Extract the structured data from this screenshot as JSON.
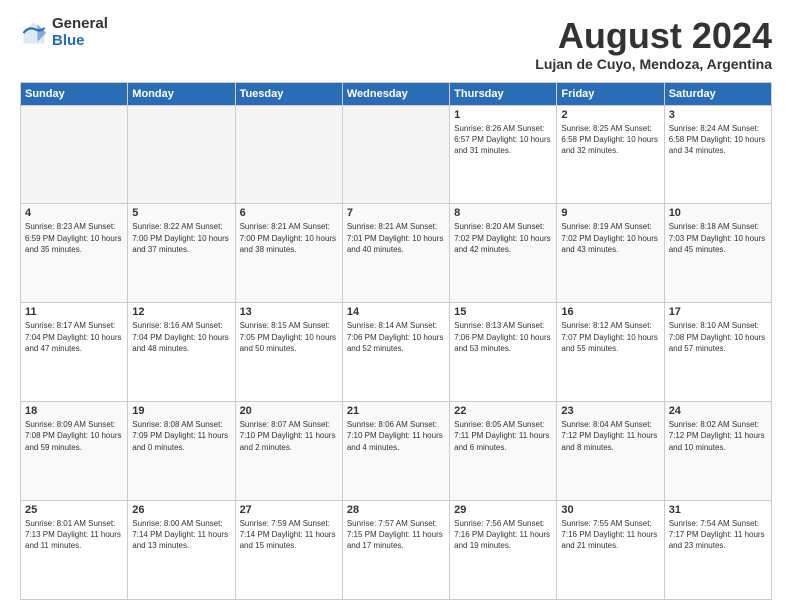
{
  "logo": {
    "general": "General",
    "blue": "Blue"
  },
  "title": "August 2024",
  "subtitle": "Lujan de Cuyo, Mendoza, Argentina",
  "headers": [
    "Sunday",
    "Monday",
    "Tuesday",
    "Wednesday",
    "Thursday",
    "Friday",
    "Saturday"
  ],
  "weeks": [
    [
      {
        "day": "",
        "info": ""
      },
      {
        "day": "",
        "info": ""
      },
      {
        "day": "",
        "info": ""
      },
      {
        "day": "",
        "info": ""
      },
      {
        "day": "1",
        "info": "Sunrise: 8:26 AM\nSunset: 6:57 PM\nDaylight: 10 hours\nand 31 minutes."
      },
      {
        "day": "2",
        "info": "Sunrise: 8:25 AM\nSunset: 6:58 PM\nDaylight: 10 hours\nand 32 minutes."
      },
      {
        "day": "3",
        "info": "Sunrise: 8:24 AM\nSunset: 6:58 PM\nDaylight: 10 hours\nand 34 minutes."
      }
    ],
    [
      {
        "day": "4",
        "info": "Sunrise: 8:23 AM\nSunset: 6:59 PM\nDaylight: 10 hours\nand 35 minutes."
      },
      {
        "day": "5",
        "info": "Sunrise: 8:22 AM\nSunset: 7:00 PM\nDaylight: 10 hours\nand 37 minutes."
      },
      {
        "day": "6",
        "info": "Sunrise: 8:21 AM\nSunset: 7:00 PM\nDaylight: 10 hours\nand 38 minutes."
      },
      {
        "day": "7",
        "info": "Sunrise: 8:21 AM\nSunset: 7:01 PM\nDaylight: 10 hours\nand 40 minutes."
      },
      {
        "day": "8",
        "info": "Sunrise: 8:20 AM\nSunset: 7:02 PM\nDaylight: 10 hours\nand 42 minutes."
      },
      {
        "day": "9",
        "info": "Sunrise: 8:19 AM\nSunset: 7:02 PM\nDaylight: 10 hours\nand 43 minutes."
      },
      {
        "day": "10",
        "info": "Sunrise: 8:18 AM\nSunset: 7:03 PM\nDaylight: 10 hours\nand 45 minutes."
      }
    ],
    [
      {
        "day": "11",
        "info": "Sunrise: 8:17 AM\nSunset: 7:04 PM\nDaylight: 10 hours\nand 47 minutes."
      },
      {
        "day": "12",
        "info": "Sunrise: 8:16 AM\nSunset: 7:04 PM\nDaylight: 10 hours\nand 48 minutes."
      },
      {
        "day": "13",
        "info": "Sunrise: 8:15 AM\nSunset: 7:05 PM\nDaylight: 10 hours\nand 50 minutes."
      },
      {
        "day": "14",
        "info": "Sunrise: 8:14 AM\nSunset: 7:06 PM\nDaylight: 10 hours\nand 52 minutes."
      },
      {
        "day": "15",
        "info": "Sunrise: 8:13 AM\nSunset: 7:06 PM\nDaylight: 10 hours\nand 53 minutes."
      },
      {
        "day": "16",
        "info": "Sunrise: 8:12 AM\nSunset: 7:07 PM\nDaylight: 10 hours\nand 55 minutes."
      },
      {
        "day": "17",
        "info": "Sunrise: 8:10 AM\nSunset: 7:08 PM\nDaylight: 10 hours\nand 57 minutes."
      }
    ],
    [
      {
        "day": "18",
        "info": "Sunrise: 8:09 AM\nSunset: 7:08 PM\nDaylight: 10 hours\nand 59 minutes."
      },
      {
        "day": "19",
        "info": "Sunrise: 8:08 AM\nSunset: 7:09 PM\nDaylight: 11 hours\nand 0 minutes."
      },
      {
        "day": "20",
        "info": "Sunrise: 8:07 AM\nSunset: 7:10 PM\nDaylight: 11 hours\nand 2 minutes."
      },
      {
        "day": "21",
        "info": "Sunrise: 8:06 AM\nSunset: 7:10 PM\nDaylight: 11 hours\nand 4 minutes."
      },
      {
        "day": "22",
        "info": "Sunrise: 8:05 AM\nSunset: 7:11 PM\nDaylight: 11 hours\nand 6 minutes."
      },
      {
        "day": "23",
        "info": "Sunrise: 8:04 AM\nSunset: 7:12 PM\nDaylight: 11 hours\nand 8 minutes."
      },
      {
        "day": "24",
        "info": "Sunrise: 8:02 AM\nSunset: 7:12 PM\nDaylight: 11 hours\nand 10 minutes."
      }
    ],
    [
      {
        "day": "25",
        "info": "Sunrise: 8:01 AM\nSunset: 7:13 PM\nDaylight: 11 hours\nand 11 minutes."
      },
      {
        "day": "26",
        "info": "Sunrise: 8:00 AM\nSunset: 7:14 PM\nDaylight: 11 hours\nand 13 minutes."
      },
      {
        "day": "27",
        "info": "Sunrise: 7:59 AM\nSunset: 7:14 PM\nDaylight: 11 hours\nand 15 minutes."
      },
      {
        "day": "28",
        "info": "Sunrise: 7:57 AM\nSunset: 7:15 PM\nDaylight: 11 hours\nand 17 minutes."
      },
      {
        "day": "29",
        "info": "Sunrise: 7:56 AM\nSunset: 7:16 PM\nDaylight: 11 hours\nand 19 minutes."
      },
      {
        "day": "30",
        "info": "Sunrise: 7:55 AM\nSunset: 7:16 PM\nDaylight: 11 hours\nand 21 minutes."
      },
      {
        "day": "31",
        "info": "Sunrise: 7:54 AM\nSunset: 7:17 PM\nDaylight: 11 hours\nand 23 minutes."
      }
    ]
  ]
}
